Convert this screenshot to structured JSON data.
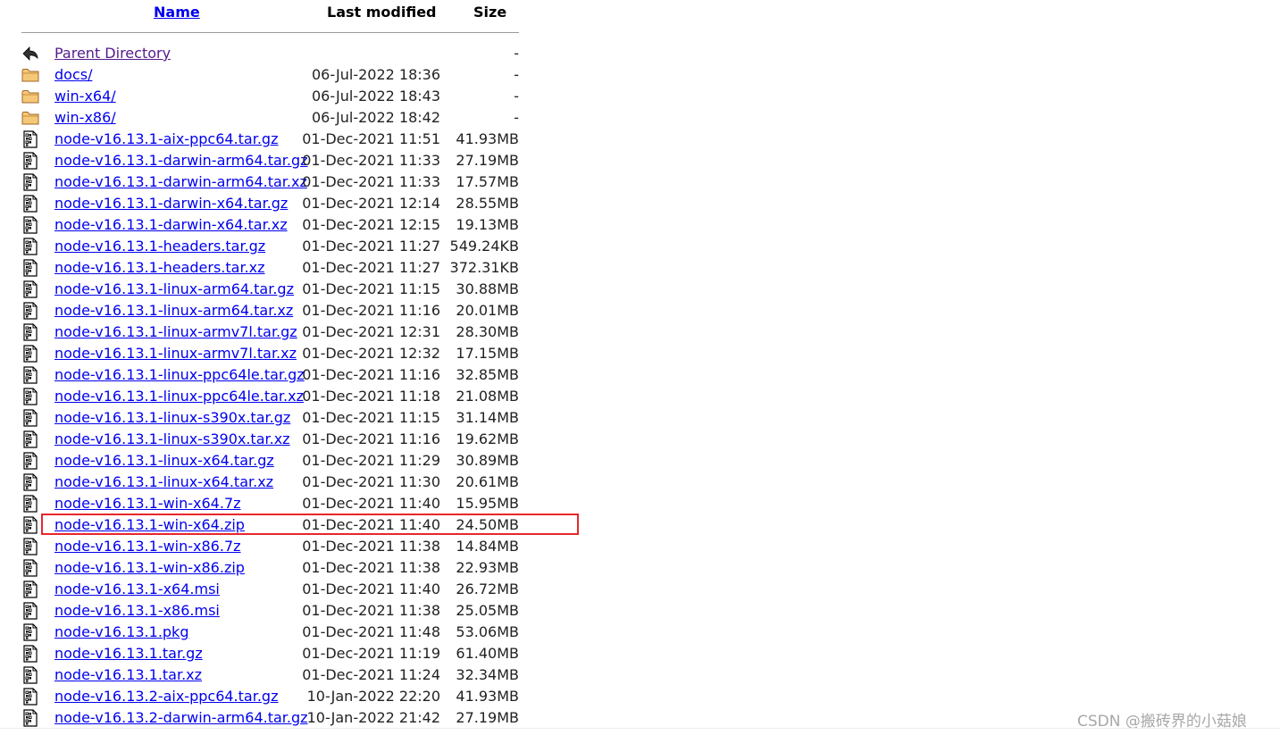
{
  "header": {
    "name_label": "Name",
    "modified_label": "Last modified",
    "size_label": "Size"
  },
  "entries": [
    {
      "name": "Parent Directory",
      "date": "",
      "size": "-",
      "type": "back-icon"
    },
    {
      "name": "docs/",
      "date": "06-Jul-2022 18:36",
      "size": "-",
      "type": "folder-icon"
    },
    {
      "name": "win-x64/",
      "date": "06-Jul-2022 18:43",
      "size": "-",
      "type": "folder-icon"
    },
    {
      "name": "win-x86/",
      "date": "06-Jul-2022 18:42",
      "size": "-",
      "type": "folder-icon"
    },
    {
      "name": "node-v16.13.1-aix-ppc64.tar.gz",
      "date": "01-Dec-2021 11:51",
      "size": "41.93MB",
      "type": "binary-file-icon"
    },
    {
      "name": "node-v16.13.1-darwin-arm64.tar.gz",
      "date": "01-Dec-2021 11:33",
      "size": "27.19MB",
      "type": "binary-file-icon"
    },
    {
      "name": "node-v16.13.1-darwin-arm64.tar.xz",
      "date": "01-Dec-2021 11:33",
      "size": "17.57MB",
      "type": "binary-file-icon"
    },
    {
      "name": "node-v16.13.1-darwin-x64.tar.gz",
      "date": "01-Dec-2021 12:14",
      "size": "28.55MB",
      "type": "binary-file-icon"
    },
    {
      "name": "node-v16.13.1-darwin-x64.tar.xz",
      "date": "01-Dec-2021 12:15",
      "size": "19.13MB",
      "type": "binary-file-icon"
    },
    {
      "name": "node-v16.13.1-headers.tar.gz",
      "date": "01-Dec-2021 11:27",
      "size": "549.24KB",
      "type": "binary-file-icon"
    },
    {
      "name": "node-v16.13.1-headers.tar.xz",
      "date": "01-Dec-2021 11:27",
      "size": "372.31KB",
      "type": "binary-file-icon"
    },
    {
      "name": "node-v16.13.1-linux-arm64.tar.gz",
      "date": "01-Dec-2021 11:15",
      "size": "30.88MB",
      "type": "binary-file-icon"
    },
    {
      "name": "node-v16.13.1-linux-arm64.tar.xz",
      "date": "01-Dec-2021 11:16",
      "size": "20.01MB",
      "type": "binary-file-icon"
    },
    {
      "name": "node-v16.13.1-linux-armv7l.tar.gz",
      "date": "01-Dec-2021 12:31",
      "size": "28.30MB",
      "type": "binary-file-icon"
    },
    {
      "name": "node-v16.13.1-linux-armv7l.tar.xz",
      "date": "01-Dec-2021 12:32",
      "size": "17.15MB",
      "type": "binary-file-icon"
    },
    {
      "name": "node-v16.13.1-linux-ppc64le.tar.gz",
      "date": "01-Dec-2021 11:16",
      "size": "32.85MB",
      "type": "binary-file-icon"
    },
    {
      "name": "node-v16.13.1-linux-ppc64le.tar.xz",
      "date": "01-Dec-2021 11:18",
      "size": "21.08MB",
      "type": "binary-file-icon"
    },
    {
      "name": "node-v16.13.1-linux-s390x.tar.gz",
      "date": "01-Dec-2021 11:15",
      "size": "31.14MB",
      "type": "binary-file-icon"
    },
    {
      "name": "node-v16.13.1-linux-s390x.tar.xz",
      "date": "01-Dec-2021 11:16",
      "size": "19.62MB",
      "type": "binary-file-icon"
    },
    {
      "name": "node-v16.13.1-linux-x64.tar.gz",
      "date": "01-Dec-2021 11:29",
      "size": "30.89MB",
      "type": "binary-file-icon"
    },
    {
      "name": "node-v16.13.1-linux-x64.tar.xz",
      "date": "01-Dec-2021 11:30",
      "size": "20.61MB",
      "type": "binary-file-icon"
    },
    {
      "name": "node-v16.13.1-win-x64.7z",
      "date": "01-Dec-2021 11:40",
      "size": "15.95MB",
      "type": "binary-file-icon"
    },
    {
      "name": "node-v16.13.1-win-x64.zip",
      "date": "01-Dec-2021 11:40",
      "size": "24.50MB",
      "type": "binary-file-icon"
    },
    {
      "name": "node-v16.13.1-win-x86.7z",
      "date": "01-Dec-2021 11:38",
      "size": "14.84MB",
      "type": "binary-file-icon"
    },
    {
      "name": "node-v16.13.1-win-x86.zip",
      "date": "01-Dec-2021 11:38",
      "size": "22.93MB",
      "type": "binary-file-icon"
    },
    {
      "name": "node-v16.13.1-x64.msi",
      "date": "01-Dec-2021 11:40",
      "size": "26.72MB",
      "type": "binary-file-icon"
    },
    {
      "name": "node-v16.13.1-x86.msi",
      "date": "01-Dec-2021 11:38",
      "size": "25.05MB",
      "type": "binary-file-icon"
    },
    {
      "name": "node-v16.13.1.pkg",
      "date": "01-Dec-2021 11:48",
      "size": "53.06MB",
      "type": "binary-file-icon"
    },
    {
      "name": "node-v16.13.1.tar.gz",
      "date": "01-Dec-2021 11:19",
      "size": "61.40MB",
      "type": "binary-file-icon"
    },
    {
      "name": "node-v16.13.1.tar.xz",
      "date": "01-Dec-2021 11:24",
      "size": "32.34MB",
      "type": "binary-file-icon"
    },
    {
      "name": "node-v16.13.2-aix-ppc64.tar.gz",
      "date": "10-Jan-2022 22:20",
      "size": "41.93MB",
      "type": "binary-file-icon"
    },
    {
      "name": "node-v16.13.2-darwin-arm64.tar.gz",
      "date": "10-Jan-2022 21:42",
      "size": "27.19MB",
      "type": "binary-file-icon"
    }
  ],
  "watermark": "CSDN @搬砖界的小菇娘",
  "colors": {
    "link": "#0000ee",
    "visited": "#551a8b",
    "highlight": "#e8262a",
    "folder": "#e8a84a"
  }
}
